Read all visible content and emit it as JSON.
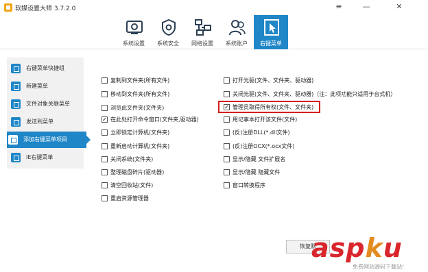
{
  "window": {
    "title": "软媒设置大师 3.7.2.0",
    "controls": [
      "≡",
      "—",
      "✕"
    ]
  },
  "tabs": [
    {
      "label": "系统设置",
      "icon": "system-settings-icon",
      "active": false
    },
    {
      "label": "系统安全",
      "icon": "shield-gear-icon",
      "active": false
    },
    {
      "label": "网络设置",
      "icon": "network-icon",
      "active": false
    },
    {
      "label": "系统账户",
      "icon": "users-icon",
      "active": false
    },
    {
      "label": "右键菜单",
      "icon": "cursor-icon",
      "active": true
    }
  ],
  "sidebar": {
    "items": [
      {
        "label": "右键菜单快捷组",
        "active": false
      },
      {
        "label": "新建菜单",
        "active": false
      },
      {
        "label": "文件对象关联菜单",
        "active": false
      },
      {
        "label": "发送到菜单",
        "active": false
      },
      {
        "label": "添加右键菜单项目",
        "active": true
      },
      {
        "label": "IE右键菜单",
        "active": false
      }
    ]
  },
  "options_left": [
    {
      "label": "复制到文件夹(所有文件)",
      "checked": false
    },
    {
      "label": "移动到文件夹(所有文件)",
      "checked": false
    },
    {
      "label": "浏览此文件夹(文件夹)",
      "checked": false
    },
    {
      "label": "在此处打开命令窗口(文件夹,驱动器)",
      "checked": true
    },
    {
      "label": "立即锁定计算机(文件夹)",
      "checked": false
    },
    {
      "label": "重新启动计算机(文件夹)",
      "checked": false
    },
    {
      "label": "关闭系统(文件夹)",
      "checked": false
    },
    {
      "label": "整理磁盘碎片(驱动器)",
      "checked": false
    },
    {
      "label": "清空回收站(文件)",
      "checked": false
    },
    {
      "label": "重启资源管理器",
      "checked": false
    }
  ],
  "options_right": [
    {
      "label": "打开光驱(文件、文件夹、驱动器)",
      "checked": false
    },
    {
      "label": "关闭光驱(文件、文件夹、驱动器)（注：此项功能只适用于台式机）",
      "checked": false
    },
    {
      "label": "管理员取得所有权(文件、文件夹)",
      "checked": true
    },
    {
      "label": "用记事本打开该文件(文件)",
      "checked": false
    },
    {
      "label": "(反)注册DLL(*.dll文件)",
      "checked": false
    },
    {
      "label": "(反)注册OCX(*.ocx文件)",
      "checked": false
    },
    {
      "label": "显示/隐藏 文件扩展名",
      "checked": false
    },
    {
      "label": "显示/隐藏 隐藏文件",
      "checked": false
    },
    {
      "label": "窗口转换程序",
      "checked": false
    }
  ],
  "restore_button": "恢复默",
  "watermark": {
    "logo": "aspku",
    "logo_a": "asp",
    "logo_dot": "k",
    "logo_b": "u",
    "sub": "免费网站源码下载站!"
  },
  "colors": {
    "accent": "#1f86c7",
    "highlight": "#d41e1e"
  }
}
